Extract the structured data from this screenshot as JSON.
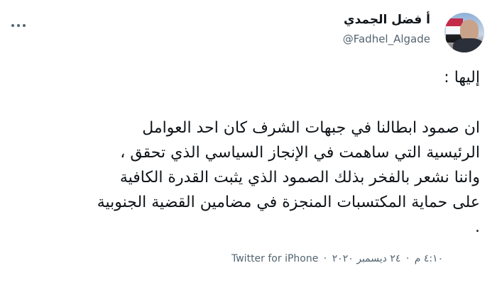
{
  "author": {
    "display_name": "أ فضل الجمدي",
    "handle": "@Fadhel_Algade"
  },
  "tweet": {
    "lines": [
      "إليها :",
      "ان صمود ابطالنا في جبهات الشرف كان احد العوامل",
      "الرئيسية التي ساهمت في الإنجاز السياسي الذي تحقق ،",
      "واننا نشعر بالفخر بذلك الصمود الذي يثبت القدرة الكافية",
      "على حماية المكتسبات المنجزة في مضامين القضية الجنوبية",
      "."
    ]
  },
  "meta": {
    "time": "٤:١٠ م",
    "date": "٢٤ ديسمبر ٢٠٢٠",
    "separator": "·",
    "source": "Twitter for iPhone"
  },
  "icons": {
    "more": "more-options-icon",
    "avatar": "profile-avatar"
  }
}
